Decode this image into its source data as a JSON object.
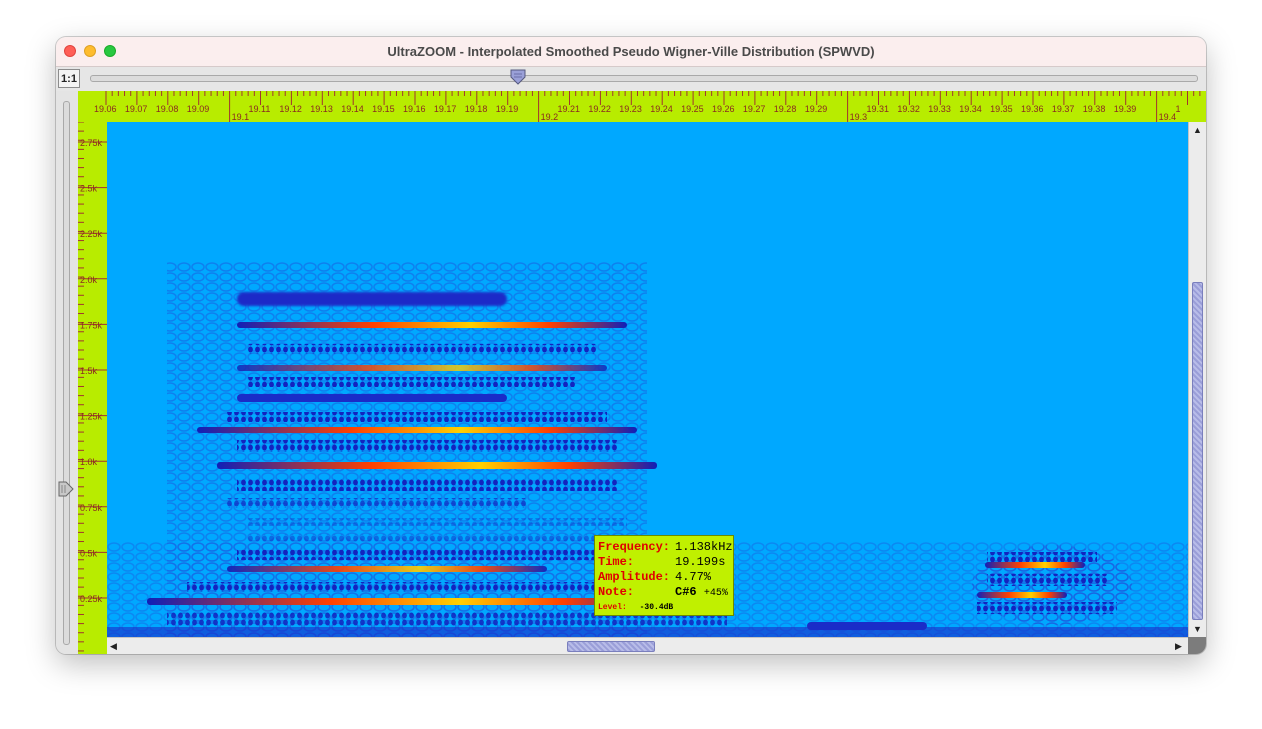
{
  "window": {
    "title": "UltraZOOM - Interpolated Smoothed Pseudo Wigner-Ville Distribution (SPWVD)"
  },
  "toolbar": {
    "zoom_reset_label": "1:1"
  },
  "time_ruler": {
    "major": [
      "19.1",
      "19.2",
      "19.3",
      "19.4"
    ],
    "minor": [
      "19.06",
      "19.07",
      "19.08",
      "19.09",
      "19.11",
      "19.12",
      "19.13",
      "19.14",
      "19.15",
      "19.16",
      "19.17",
      "19.18",
      "19.19",
      "19.21",
      "19.22",
      "19.23",
      "19.24",
      "19.25",
      "19.26",
      "19.27",
      "19.28",
      "19.29",
      "19.31",
      "19.32",
      "19.33",
      "19.34",
      "19.35",
      "19.36",
      "19.37",
      "19.38",
      "19.39",
      "1"
    ]
  },
  "freq_ruler": {
    "labels": [
      "2.75k",
      "2.5k",
      "2.25k",
      "2.0k",
      "1.75k",
      "1.5k",
      "1.25k",
      "1.0k",
      "0.75k",
      "0.5k",
      "0.25k"
    ]
  },
  "tooltip": {
    "frequency_label": "Frequency:",
    "frequency_value": "1.138kHz",
    "time_label": "Time:",
    "time_value": "19.199s",
    "amplitude_label": "Amplitude:",
    "amplitude_value": "4.77%",
    "note_label": "Note:",
    "note_value": "C#6",
    "note_cents": "+45%",
    "level_label": "Level:",
    "level_value": "-30.4dB"
  },
  "colors": {
    "background": "#00a8ff",
    "ruler": "#b8ec00",
    "ridge_low": "#0b1fb0",
    "ridge_mid": "#ff3a00",
    "ridge_hot": "#ffd000"
  },
  "icons": {
    "scroll_up": "triangle-up-icon",
    "scroll_down": "triangle-down-icon",
    "scroll_left": "triangle-left-icon",
    "scroll_right": "triangle-right-icon"
  }
}
